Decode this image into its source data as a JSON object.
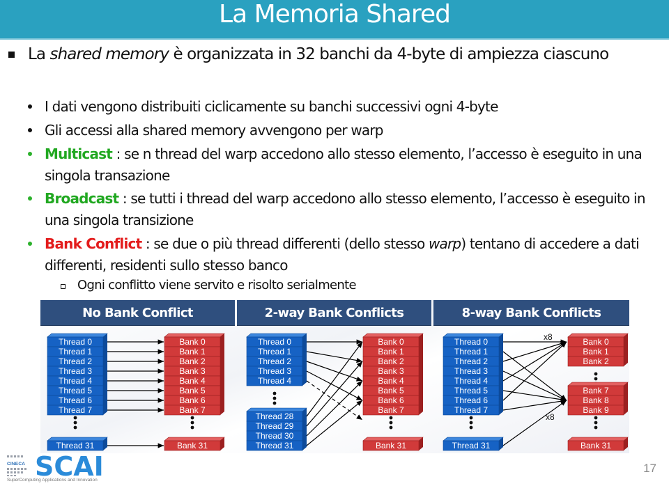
{
  "slide": {
    "title": "La Memoria Shared",
    "page_number": "17",
    "colors": {
      "title_bar": "#2aa1c0",
      "keyword_green": "#21a821",
      "keyword_red": "#e31b1b",
      "panel_header": "#2f4f7e",
      "thread_block": "#1662c4",
      "bank_block": "#d13a3a"
    }
  },
  "bullets": {
    "main": {
      "prefix": "La ",
      "italic": "shared memory",
      "suffix": " è organizzata in 32 banchi da 4-byte di ampiezza ciascuno"
    },
    "sub": [
      {
        "text": "I dati vengono distribuiti ciclicamente su banchi successivi ogni 4-byte"
      },
      {
        "text": "Gli accessi alla shared memory avvengono per warp"
      },
      {
        "keyword": "Multicast",
        "text": " : se n thread del warp accedono allo stesso elemento, l’accesso è eseguito in una singola transazione"
      },
      {
        "keyword": "Broadcast",
        "text": " : se tutti i thread del warp accedono allo stesso elemento, l’accesso è eseguito in una singola transizione"
      },
      {
        "keyword": "Bank Conflict",
        "text_before_italic": " : se due o più thread differenti (dello stesso ",
        "italic": "warp",
        "text_after_italic": ") tentano di accedere a dati differenti, residenti sullo stesso banco"
      }
    ],
    "subsub": [
      {
        "text": "Ogni conflitto viene servito e risolto serialmente"
      }
    ]
  },
  "diagram": {
    "panels": [
      {
        "title": "No Bank Conflict",
        "threads": [
          [
            "Thread 0",
            "Thread 1",
            "Thread 2",
            "Thread 3",
            "Thread 4",
            "Thread 5",
            "Thread 6",
            "Thread 7"
          ],
          [
            "Thread 31"
          ]
        ],
        "banks": [
          [
            "Bank 0",
            "Bank 1",
            "Bank 2",
            "Bank 3",
            "Bank 4",
            "Bank 5",
            "Bank 6",
            "Bank 7"
          ],
          [
            "Bank 31"
          ]
        ],
        "mapping": "thread i -> bank i"
      },
      {
        "title": "2-way Bank Conflicts",
        "threads": [
          [
            "Thread 0",
            "Thread 1",
            "Thread 2",
            "Thread 3",
            "Thread 4"
          ],
          [
            "Thread 28",
            "Thread 29",
            "Thread 30",
            "Thread 31"
          ]
        ],
        "banks": [
          [
            "Bank 0",
            "Bank 1",
            "Bank 2",
            "Bank 3",
            "Bank 4",
            "Bank 5",
            "Bank 6",
            "Bank 7"
          ],
          [
            "Bank 31"
          ]
        ],
        "mapping": "thread i -> bank 2i mod 32"
      },
      {
        "title": "8-way Bank Conflicts",
        "threads": [
          [
            "Thread 0",
            "Thread 1",
            "Thread 2",
            "Thread 3",
            "Thread 4",
            "Thread 5",
            "Thread 6",
            "Thread 7"
          ],
          [
            "Thread 31"
          ]
        ],
        "banks": [
          [
            "Bank 0",
            "Bank 1",
            "Bank 2"
          ],
          [
            "Bank 7",
            "Bank 8",
            "Bank 9"
          ],
          [
            "Bank 31"
          ]
        ],
        "annotations": [
          "x8",
          "x8"
        ],
        "mapping": "8 threads -> bank 0, 8 threads -> bank 8"
      }
    ]
  },
  "footer": {
    "logo_org": "CINECA",
    "logo_name": "SCAI",
    "logo_subtitle": "SuperComputing Applications and Innovation"
  }
}
